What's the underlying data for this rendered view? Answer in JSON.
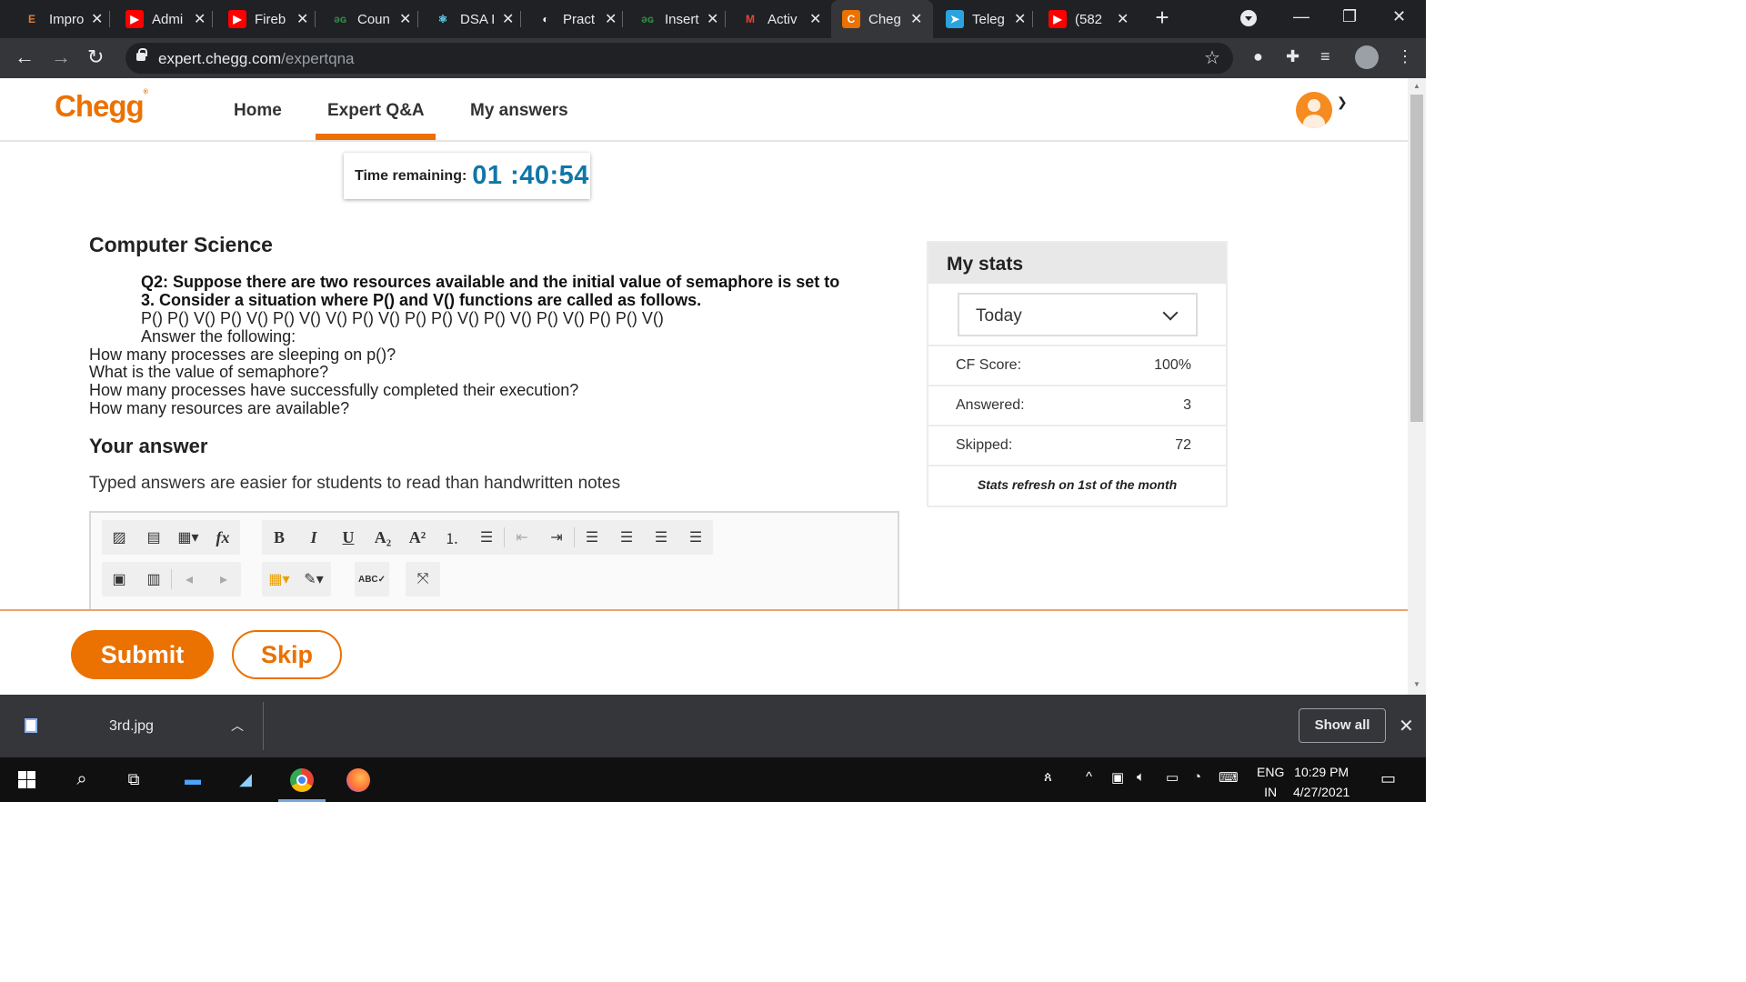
{
  "browser": {
    "tabs": [
      {
        "title": "Impro",
        "favicon": "E",
        "color": "#202124",
        "fg": "#e07b39"
      },
      {
        "title": "Admi",
        "favicon": "▶",
        "color": "#ff0000",
        "fg": "#fff"
      },
      {
        "title": "Fireb",
        "favicon": "▶",
        "color": "#ff0000",
        "fg": "#fff"
      },
      {
        "title": "Coun",
        "favicon": "ǝɢ",
        "color": "#202124",
        "fg": "#2f8d46"
      },
      {
        "title": "DSA I",
        "favicon": "⚛",
        "color": "#202124",
        "fg": "#61dafb"
      },
      {
        "title": "Pract",
        "favicon": "◐",
        "color": "#202124",
        "fg": "#fff"
      },
      {
        "title": "Insert",
        "favicon": "ǝɢ",
        "color": "#202124",
        "fg": "#2f8d46"
      },
      {
        "title": "Activ",
        "favicon": "M",
        "color": "#202124",
        "fg": "#ea4335"
      },
      {
        "title": "Cheg",
        "favicon": "C",
        "color": "#eb7100",
        "fg": "#fff"
      },
      {
        "title": "Teleg",
        "favicon": "➤",
        "color": "#2aa3df",
        "fg": "#fff"
      },
      {
        "title": "(582",
        "favicon": "▶",
        "color": "#ff0000",
        "fg": "#fff"
      }
    ],
    "active_tab_index": 8,
    "url_host": "expert.chegg.com",
    "url_path": "/expertqna"
  },
  "header": {
    "logo": "Chegg",
    "nav": [
      "Home",
      "Expert Q&A",
      "My answers"
    ],
    "active_nav": "Expert Q&A"
  },
  "timer": {
    "label": "Time remaining:",
    "value": "01 :40:54"
  },
  "question": {
    "subject": "Computer Science",
    "bold_text": "Q2: Suppose there are two resources available and the initial value of semaphore is set to 3. Consider a situation where P() and V() functions are called as follows.",
    "sequence": "P() P() V() P() V() P() V() V() P() V() P() P() V() P() V() P() V() P() P() V()",
    "instruction": "Answer the following:",
    "sub_questions": [
      "How many processes are sleeping on p()?",
      "What is the value of semaphore?",
      "How many processes have successfully completed their execution?",
      "How many resources are available?"
    ]
  },
  "answer": {
    "heading": "Your answer",
    "hint": "Typed answers are easier for students to read than handwritten notes"
  },
  "stats": {
    "title": "My stats",
    "period": "Today",
    "rows": [
      {
        "label": "CF Score:",
        "value": "100%"
      },
      {
        "label": "Answered:",
        "value": "3"
      },
      {
        "label": "Skipped:",
        "value": "72"
      }
    ],
    "note": "Stats refresh on 1st of the month"
  },
  "actions": {
    "submit": "Submit",
    "skip": "Skip"
  },
  "downloads": {
    "file": "3rd.jpg",
    "show_all": "Show all"
  },
  "taskbar": {
    "lang_top": "ENG",
    "lang_bottom": "IN",
    "time": "10:29 PM",
    "date": "4/27/2021"
  },
  "colors": {
    "brand": "#eb7100",
    "timer": "#0f77a7"
  }
}
